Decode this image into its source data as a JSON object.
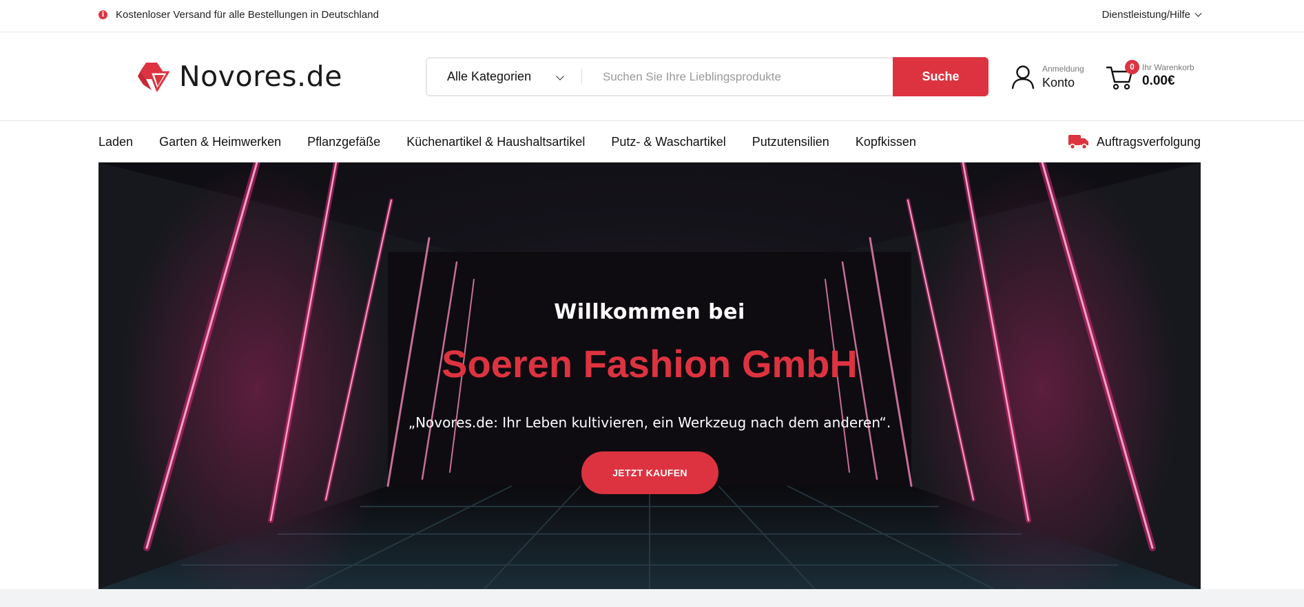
{
  "topbar": {
    "notice": "Kostenloser Versand für alle Bestellungen in Deutschland",
    "help_label": "Dienstleistung/Hilfe",
    "icons": {
      "info": "info-icon",
      "chevron": "chevron-down-icon"
    }
  },
  "header": {
    "logo_text": "Novores.de",
    "search": {
      "category": "Alle Kategorien",
      "placeholder": "Suchen Sie Ihre Lieblingsprodukte",
      "button": "Suche"
    },
    "account": {
      "small": "Anmeldung",
      "big": "Konto"
    },
    "cart": {
      "count": "0",
      "small": "Ihr Warenkorb",
      "total": "0.00€"
    }
  },
  "nav": {
    "items": [
      "Laden",
      "Garten & Heimwerken",
      "Pflanzgefäße",
      "Küchenartikel & Haushaltsartikel",
      "Putz- & Waschartikel",
      "Putzutensilien",
      "Kopfkissen"
    ],
    "tracking": "Auftragsverfolgung"
  },
  "hero": {
    "welcome": "Willkommen bei",
    "brand": "Soeren Fashion GmbH",
    "tagline": "„Novores.de: Ihr Leben kultivieren, ein Werkzeug nach dem anderen“.",
    "cta": "JETZT KAUFEN"
  },
  "colors": {
    "accent": "#dd3340",
    "neon": "#e0287a",
    "text": "#111111"
  }
}
